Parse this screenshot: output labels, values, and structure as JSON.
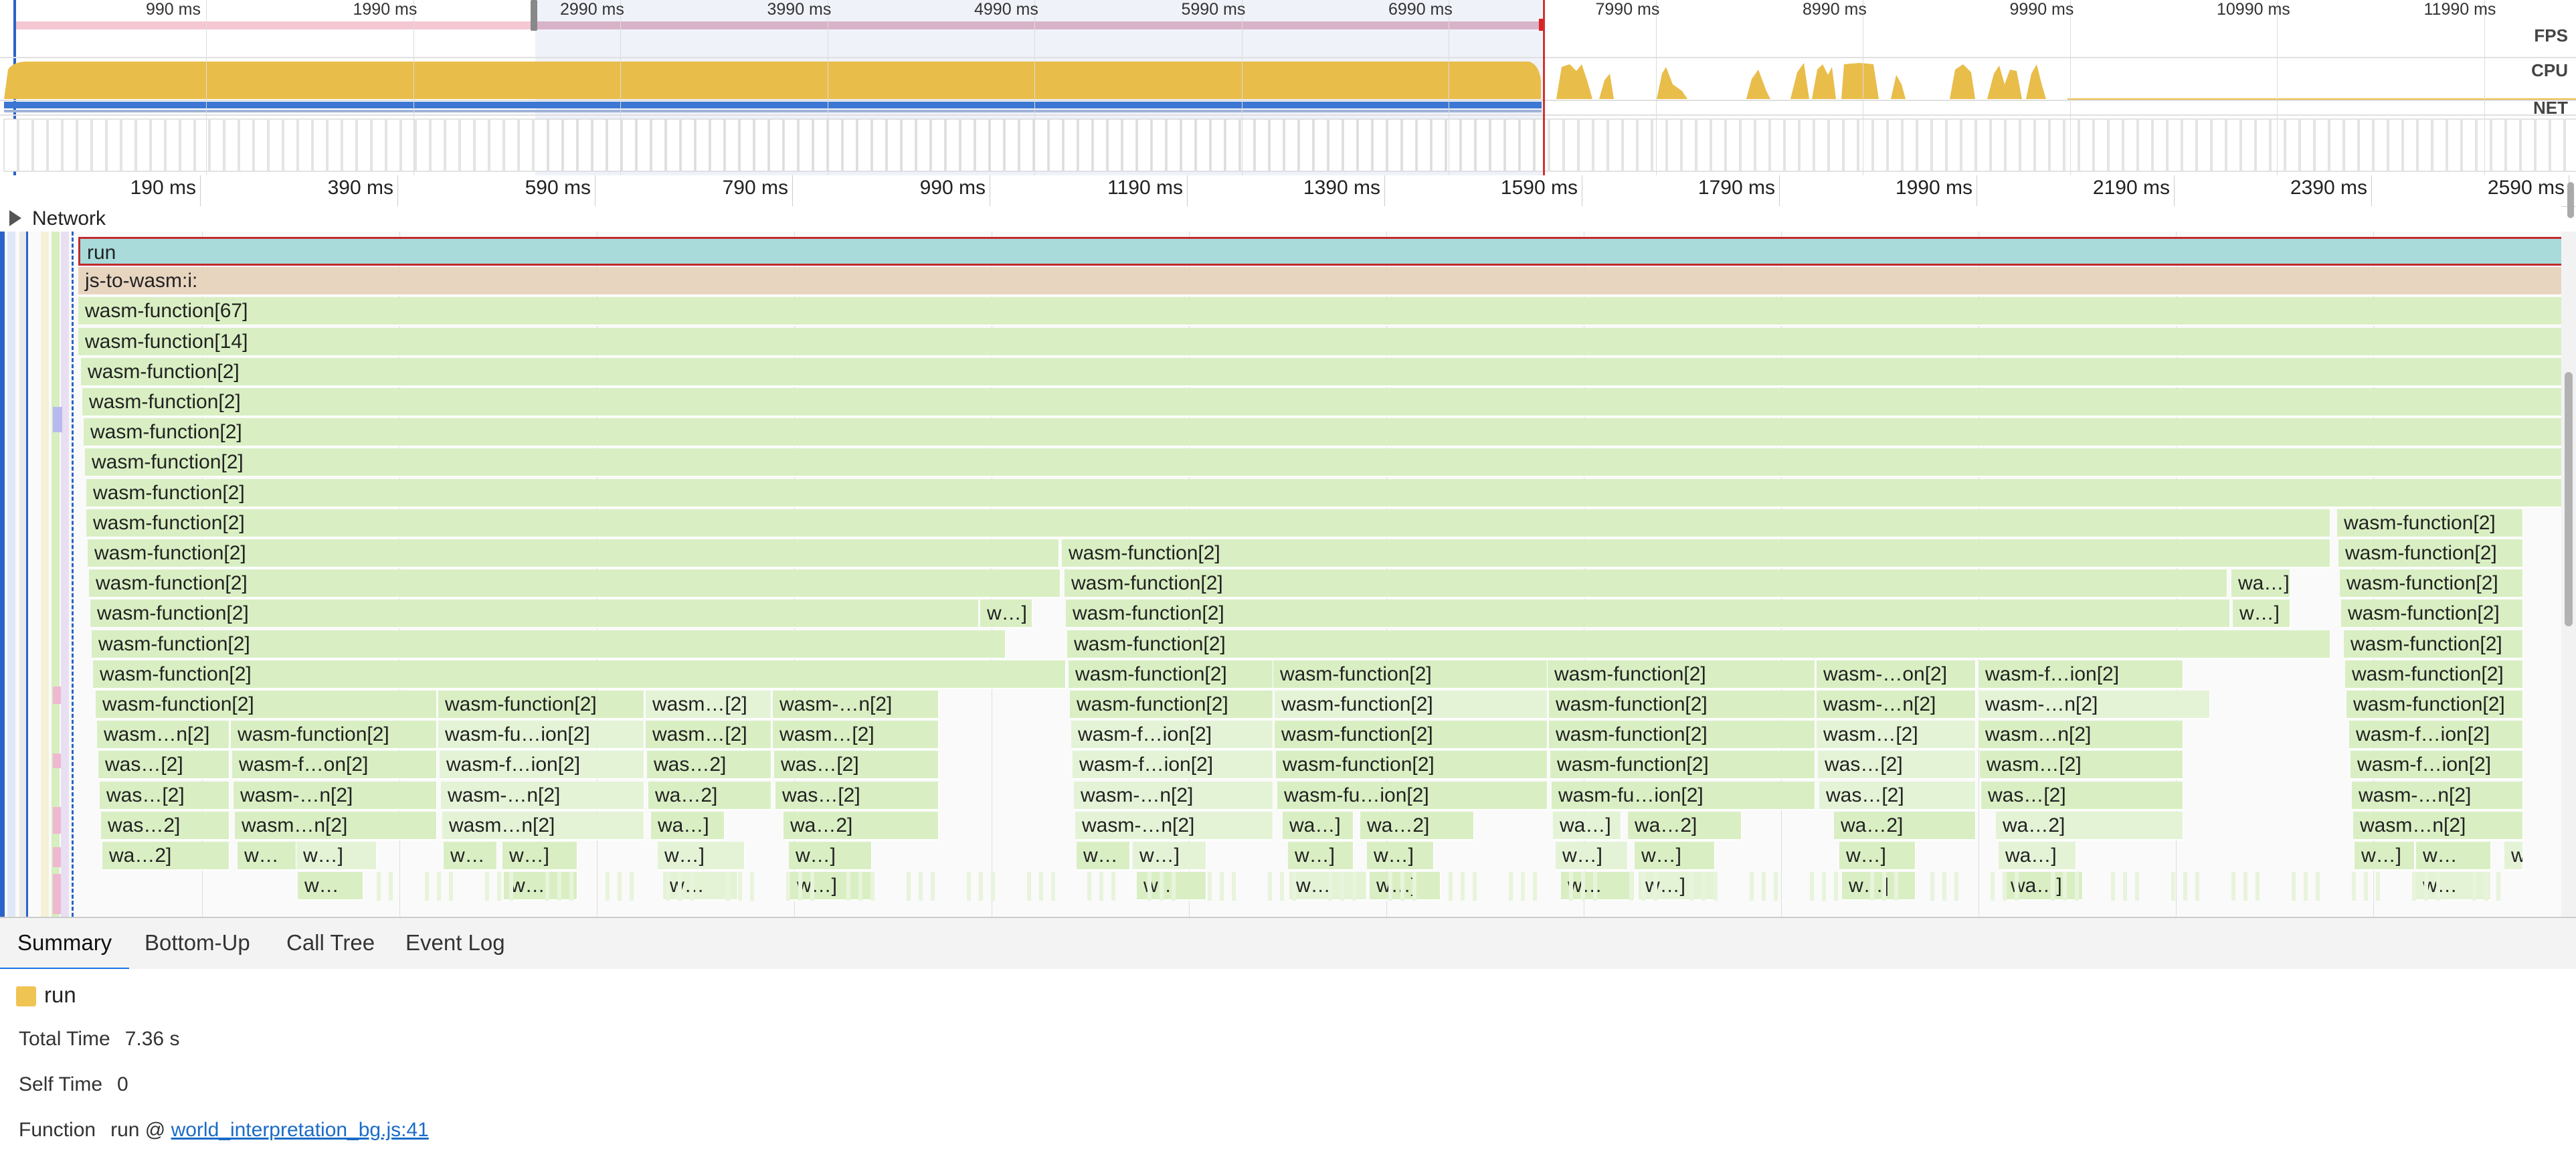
{
  "overview": {
    "ticks": [
      "990 ms",
      "1990 ms",
      "2990 ms",
      "3990 ms",
      "4990 ms",
      "5990 ms",
      "6990 ms",
      "7990 ms",
      "8990 ms",
      "9990 ms",
      "10990 ms",
      "11990 ms"
    ],
    "track_labels": {
      "fps": "FPS",
      "cpu": "CPU",
      "net": "NET"
    },
    "colors": {
      "cpu": "#e8bd4a",
      "fps_bar": "#f4c7d3",
      "net": "#3b77d3",
      "selection": "#ccd5f0"
    }
  },
  "ruler": {
    "ticks": [
      "190 ms",
      "390 ms",
      "590 ms",
      "790 ms",
      "990 ms",
      "1190 ms",
      "1390 ms",
      "1590 ms",
      "1790 ms",
      "1990 ms",
      "2190 ms",
      "2390 ms",
      "2590 ms"
    ]
  },
  "network": {
    "label": "Network"
  },
  "flame": {
    "rows": [
      [
        {
          "label": "run",
          "kind": "run"
        }
      ],
      [
        {
          "label": "js-to-wasm:i:",
          "kind": "js"
        }
      ],
      [
        {
          "label": "wasm-function[67]"
        }
      ],
      [
        {
          "label": "wasm-function[14]"
        }
      ],
      [
        {
          "label": "wasm-function[2]"
        }
      ],
      [
        {
          "label": "wasm-function[2]"
        }
      ],
      [
        {
          "label": "wasm-function[2]"
        }
      ],
      [
        {
          "label": "wasm-function[2]"
        }
      ],
      [
        {
          "label": "wasm-function[2]"
        }
      ],
      [
        {
          "label": "wasm-function[2]"
        },
        {
          "label": "wasm-function[2]"
        }
      ],
      [
        {
          "label": "wasm-function[2]"
        },
        {
          "label": "wasm-function[2]"
        },
        {
          "label": "wasm-function[2]"
        }
      ],
      [
        {
          "label": "wasm-function[2]"
        },
        {
          "label": "wasm-function[2]"
        },
        {
          "label": "wa…]"
        },
        {
          "label": "wasm-function[2]"
        }
      ],
      [
        {
          "label": "wasm-function[2]"
        },
        {
          "label": "w…]"
        },
        {
          "label": "wasm-function[2]"
        },
        {
          "label": "w…]"
        },
        {
          "label": "wasm-function[2]"
        }
      ],
      [
        {
          "label": "wasm-function[2]"
        },
        {
          "label": "wasm-function[2]"
        },
        {
          "label": "wasm-function[2]"
        }
      ],
      [
        {
          "label": "wasm-function[2]"
        },
        {
          "label": "wasm-function[2]"
        },
        {
          "label": "wasm-function[2]"
        },
        {
          "label": "wasm-function[2]"
        },
        {
          "label": "wasm-…on[2]"
        },
        {
          "label": "wasm-f…ion[2]"
        },
        {
          "label": "wasm-function[2]"
        }
      ],
      [
        {
          "label": "wasm-function[2]"
        },
        {
          "label": "wasm-function[2]"
        },
        {
          "label": "wasm…[2]"
        },
        {
          "label": "wasm-…n[2]"
        },
        {
          "label": "wasm-function[2]"
        },
        {
          "label": "wasm-function[2]"
        },
        {
          "label": "wasm-function[2]"
        },
        {
          "label": "wasm-…n[2]"
        },
        {
          "label": "wasm-…n[2]"
        },
        {
          "label": "wasm-function[2]"
        }
      ],
      [
        {
          "label": "wasm…n[2]"
        },
        {
          "label": "wasm-function[2]"
        },
        {
          "label": "wasm-fu…ion[2]"
        },
        {
          "label": "wasm…[2]"
        },
        {
          "label": "wasm…[2]"
        },
        {
          "label": "wasm-f…ion[2]"
        },
        {
          "label": "wasm-function[2]"
        },
        {
          "label": "wasm-function[2]"
        },
        {
          "label": "wasm…[2]"
        },
        {
          "label": "wasm…n[2]"
        },
        {
          "label": "wasm-f…ion[2]"
        }
      ],
      [
        {
          "label": "was…[2]"
        },
        {
          "label": "wasm-f…on[2]"
        },
        {
          "label": "wasm-f…ion[2]"
        },
        {
          "label": "was…2]"
        },
        {
          "label": "was…[2]"
        },
        {
          "label": "wasm-f…ion[2]"
        },
        {
          "label": "wasm-function[2]"
        },
        {
          "label": "wasm-function[2]"
        },
        {
          "label": "was…[2]"
        },
        {
          "label": "wasm…[2]"
        },
        {
          "label": "wasm-f…ion[2]"
        }
      ],
      [
        {
          "label": "was…[2]"
        },
        {
          "label": "wasm-…n[2]"
        },
        {
          "label": "wasm-…n[2]"
        },
        {
          "label": "wa…2]"
        },
        {
          "label": "was…[2]"
        },
        {
          "label": "wasm-…n[2]"
        },
        {
          "label": "wasm-fu…ion[2]"
        },
        {
          "label": "wasm-fu…ion[2]"
        },
        {
          "label": "was…[2]"
        },
        {
          "label": "was…[2]"
        },
        {
          "label": "wasm-…n[2]"
        }
      ],
      [
        {
          "label": "was…2]"
        },
        {
          "label": "wasm…n[2]"
        },
        {
          "label": "wasm…n[2]"
        },
        {
          "label": "wa…]"
        },
        {
          "label": "wa…2]"
        },
        {
          "label": "wasm-…n[2]"
        },
        {
          "label": "wa…]"
        },
        {
          "label": "wa…2]"
        },
        {
          "label": "wa…]"
        },
        {
          "label": "wa…2]"
        },
        {
          "label": "wa…2]"
        },
        {
          "label": "wa…2]"
        },
        {
          "label": "wasm…n[2]"
        }
      ],
      [
        {
          "label": "wa…2]"
        },
        {
          "label": "w…"
        },
        {
          "label": "w…]"
        },
        {
          "label": "w…"
        },
        {
          "label": "w…]"
        },
        {
          "label": "w…]"
        },
        {
          "label": "w…]"
        },
        {
          "label": "w…"
        },
        {
          "label": "w…]"
        },
        {
          "label": "w…]"
        },
        {
          "label": "w…]"
        },
        {
          "label": "w…]"
        },
        {
          "label": "w…]"
        },
        {
          "label": "w…]"
        },
        {
          "label": "wa…]"
        },
        {
          "label": "w…]"
        },
        {
          "label": "w…"
        },
        {
          "label": "w…]"
        }
      ],
      [
        {
          "label": "w…"
        },
        {
          "label": "w…"
        },
        {
          "label": "w…"
        },
        {
          "label": "w…]"
        },
        {
          "label": "w…"
        },
        {
          "label": "w…"
        },
        {
          "label": "w…]"
        },
        {
          "label": "w…"
        },
        {
          "label": "w…]"
        },
        {
          "label": "w…]"
        },
        {
          "label": "wa…]"
        },
        {
          "label": "w…"
        }
      ]
    ]
  },
  "tabs": [
    "Summary",
    "Bottom-Up",
    "Call Tree",
    "Event Log"
  ],
  "summary": {
    "title": "run",
    "swatch_color": "#f0c453",
    "total_time_label": "Total Time",
    "total_time": "7.36 s",
    "self_time_label": "Self Time",
    "self_time": "0",
    "function_label": "Function",
    "function_prefix": "run @",
    "function_link": "world_interpretation_bg.js:41"
  }
}
